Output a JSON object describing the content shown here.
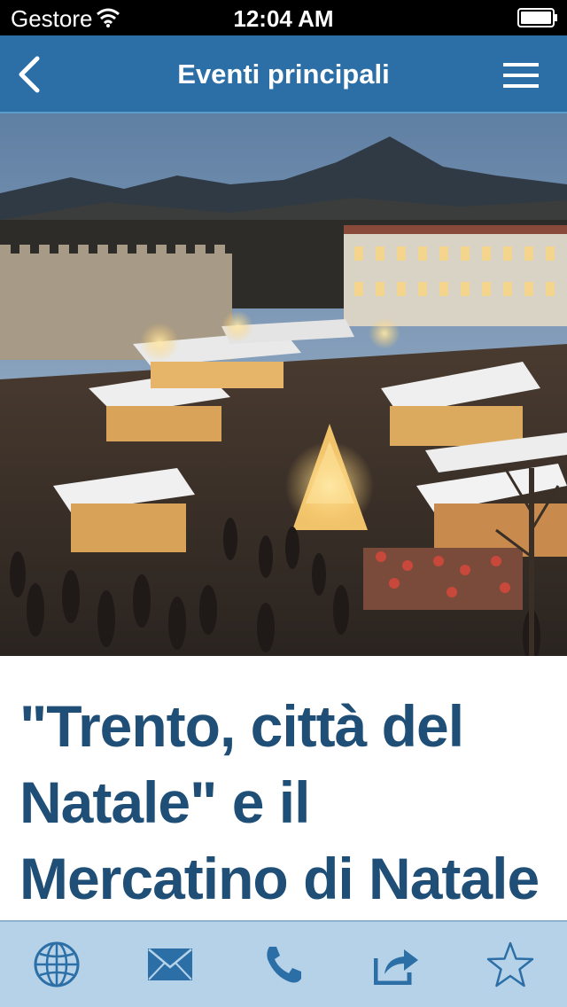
{
  "status_bar": {
    "carrier": "Gestore",
    "time": "12:04 AM",
    "icons": [
      "wifi-icon",
      "battery-icon"
    ]
  },
  "nav_bar": {
    "title": "Eventi principali",
    "back_icon": "chevron-left-icon",
    "menu_icon": "hamburger-menu-icon"
  },
  "hero": {
    "image_name": "christmas-market-photo"
  },
  "article": {
    "headline": "\"Trento, città del Natale\" e il Mercatino di Natale"
  },
  "tab_bar": {
    "items": [
      {
        "icon": "globe-icon"
      },
      {
        "icon": "mail-icon"
      },
      {
        "icon": "phone-icon"
      },
      {
        "icon": "share-icon"
      },
      {
        "icon": "star-icon"
      }
    ]
  },
  "colors": {
    "nav_bar": "#2c6fa7",
    "headline": "#1f4e76",
    "tab_bar": "#b6d2e9",
    "tab_icon": "#2c6fa7"
  }
}
